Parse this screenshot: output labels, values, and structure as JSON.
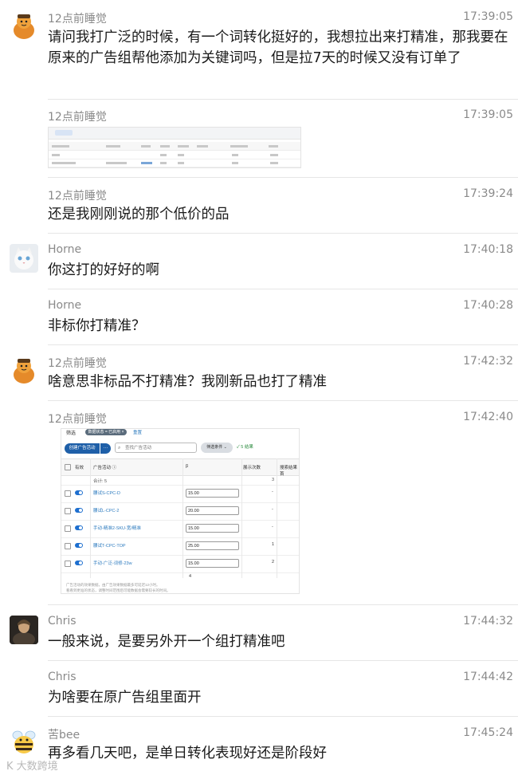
{
  "messages": [
    {
      "sender": "12点前睡觉",
      "time": "17:39:05",
      "text": "请问我打广泛的时候，有一个词转化挺好的，我想拉出来打精准，那我要在原来的广告组帮他添加为关键词吗，但是拉7天的时候又没有订单了"
    },
    {
      "sender": "12点前睡觉",
      "time": "17:39:05"
    },
    {
      "sender": "12点前睡觉",
      "time": "17:39:24",
      "text": "还是我刚刚说的那个低价的品"
    },
    {
      "sender": "Horne",
      "time": "17:40:18",
      "text": "你这打的好好的啊"
    },
    {
      "sender": "Horne",
      "time": "17:40:28",
      "text": "非标你打精准？"
    },
    {
      "sender": "12点前睡觉",
      "time": "17:42:32",
      "text": "啥意思非标品不打精准？我刚新品也打了精准"
    },
    {
      "sender": "12点前睡觉",
      "time": "17:42:40"
    },
    {
      "sender": "Chris",
      "time": "17:44:32",
      "text": "一般来说，是要另外开一个组打精准吧"
    },
    {
      "sender": "Chris",
      "time": "17:44:42",
      "text": "为啥要在原广告组里面开"
    },
    {
      "sender": "苦bee",
      "time": "17:45:24",
      "text": "再多看几天吧，是单日转化表现好还是阶段好"
    }
  ],
  "screenshot2": {
    "filter_label": "筛选",
    "filter_pill": "数据状态 = 已启用 ×",
    "reset_label": "重置",
    "create_button": "创建广告活动",
    "more_button": "···",
    "search_placeholder": "查找广告活动",
    "filter_select": "筛选条件 ⌄",
    "saved_label": "✓ 5 结果",
    "headers": {
      "active": "有效",
      "campaign": "广告活动 ⓘ",
      "budget": "β",
      "impressions": "展示次数",
      "last_col": "搜索结果首"
    },
    "total_label": "合计: 5",
    "total_impressions": "3",
    "rows": [
      {
        "name": "腰试S-CPC-D",
        "budget": "15.00",
        "impressions": "-"
      },
      {
        "name": "腰试L-CPC-2",
        "budget": "20.00",
        "impressions": "-"
      },
      {
        "name": "手动-精准2-SKU-宽/精准",
        "budget": "15.00",
        "impressions": "-"
      },
      {
        "name": "腰试T-CPC-TOP",
        "budget": "25.00",
        "impressions": "1"
      },
      {
        "name": "手动-广泛-词修-23w",
        "budget": "15.00",
        "impressions": "2"
      }
    ],
    "page_number": "4",
    "footer_line1": "广告活动的效果数据，由广告效果数据最多可延迟12小时。",
    "footer_line2": "看看到更准的状态，调整时间范围后可能数据会需要较长的时间。"
  },
  "watermark": "K 大数跨境"
}
